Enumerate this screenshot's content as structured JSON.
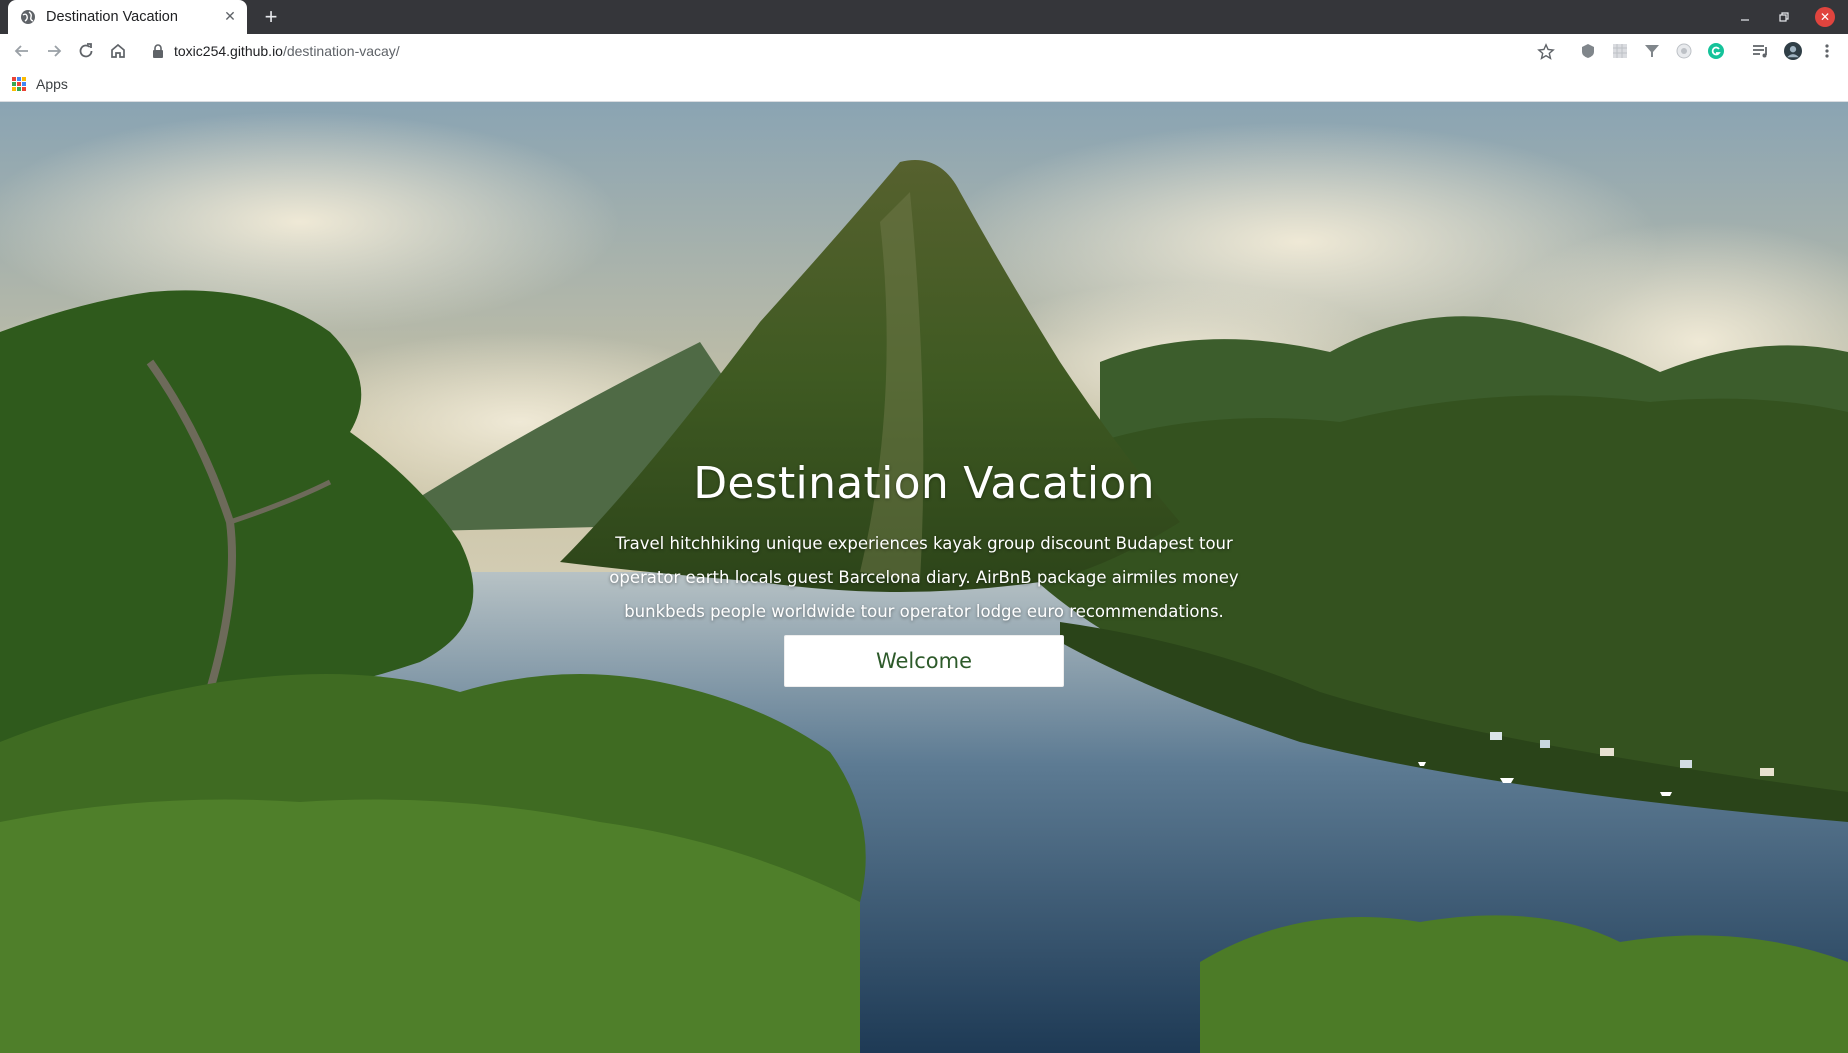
{
  "browser": {
    "tab": {
      "title": "Destination Vacation",
      "favicon": "globe-icon",
      "close": "✕"
    },
    "new_tab": "+",
    "address": {
      "host": "toxic254.github.io",
      "path": "/destination-vacay/"
    },
    "bookmarks": [
      {
        "label": "Apps",
        "icon": "apps-grid-icon"
      }
    ],
    "colors": {
      "frame": "#35363a",
      "close_button": "#e0443e"
    }
  },
  "hero": {
    "title": "Destination Vacation",
    "text": "Travel hitchhiking unique experiences kayak group discount Budapest tour operator earth locals guest Barcelona diary. AirBnB package airmiles money bunkbeds people worldwide tour operator lodge euro recommendations.",
    "button": "Welcome",
    "colors": {
      "button_text": "#2d5a2a",
      "button_bg": "#ffffff"
    }
  }
}
